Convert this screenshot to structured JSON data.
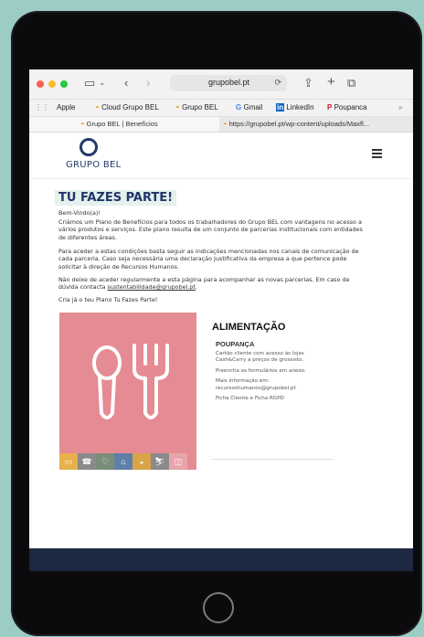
{
  "browser": {
    "url": "grupobel.pt",
    "bookmarks": [
      "Apple",
      "Cloud Grupo BEL",
      "Grupo BEL",
      "Gmail",
      "LinkedIn",
      "Poupanca"
    ],
    "tabs": [
      "Grupo BEL | Benefícios",
      "https://grupobel.pt/wp-content/uploads/Maxfl..."
    ],
    "more_glyph": "»"
  },
  "site": {
    "logo_text": "GRUPO BEL",
    "title": "TU FAZES PARTE!",
    "greeting": "Bem-Vindo(a)!",
    "intro": "Criámos um Plano de Benefícios para todos os trabalhadores do Grupo BEL com vantagens no acesso a vários produtos e serviços. Este plano resulta de um conjunto de parcerias institucionais com entidades de diferentes áreas.",
    "access": "Para aceder a estas condições basta seguir as indicações mencionadas nos canais de comunicação de cada parceria. Caso seja necessária uma declaração justificativa da empresa a que pertence pode solicitar à direção de Recursos Humanos.",
    "follow_prefix": "Não deixe de aceder regularmente a esta página para acompanhar as novas parcerias. Em caso de dúvida contacta ",
    "follow_email": "sustentabilidade@grupobel.pt",
    "follow_suffix": ".",
    "cta": "Cria já o teu Plano Tu Fazes Parte!"
  },
  "section": {
    "title": "ALIMENTAÇÃO",
    "subtitle": "POUPANÇA",
    "desc": "Cartão cliente com acesso às lojas Cash&Carry a preços de grossisto.",
    "forms": "Preencha os formulários em anexo.",
    "more_info_label": "Mais informação em:",
    "more_info_email": "recursoshumanos@grupobel.pt",
    "files": "Ficha Cliente e Ficha RGPD"
  },
  "category_colors": [
    "#e6b04a",
    "#8a8a8a",
    "#7a8d78",
    "#5e7fa8",
    "#d9a34a",
    "#8a8a8a",
    "#e8a4aa"
  ]
}
